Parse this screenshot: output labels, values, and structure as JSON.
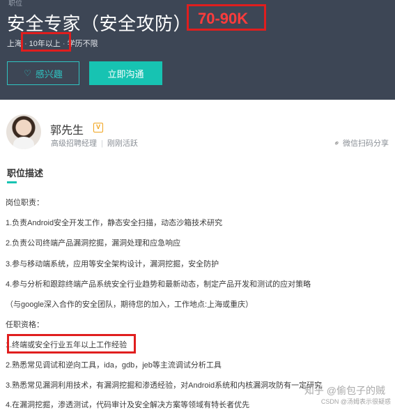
{
  "header": {
    "top_fragment": "职位",
    "title": "安全专家（安全攻防）",
    "salary": "70-90K",
    "meta": {
      "city": "上海",
      "experience": "10年以上",
      "education": "学历不限"
    },
    "interest_button": "感兴趣",
    "contact_button": "立即沟通"
  },
  "recruiter": {
    "name": "郭先生",
    "verified_mark": "V",
    "role": "高级招聘经理",
    "status": "刚刚活跃",
    "share_label": "微信扫码分享"
  },
  "description": {
    "section_title": "职位描述",
    "lines": [
      "岗位职责：",
      "1.负责Android安全开发工作，静态安全扫描，动态沙箱技术研究",
      "2.负责公司终端产品漏洞挖掘，漏洞处理和应急响应",
      "3.参与移动端系统，应用等安全架构设计，漏洞挖掘，安全防护",
      "4.参与分析和跟踪终端产品系统安全行业趋势和最新动态，制定产品开发和测试的应对策略",
      "（与google深入合作的安全团队，期待您的加入，工作地点:上海或重庆）",
      "任职资格：",
      "1.终端或安全行业五年以上工作经验",
      "2.熟悉常见调试和逆向工具，ida，gdb，jeb等主流调试分析工具",
      "3.熟悉常见漏洞利用技术，有漏洞挖掘和渗透经验，对Android系统和内核漏洞攻防有一定研究",
      "4.在漏洞挖掘，渗透测试，代码审计及安全解决方案等领域有特长者优先"
    ]
  },
  "watermark": {
    "main": "知乎 @偷包子的贼",
    "sub": "CSDN @汤姆表示很疑惑"
  },
  "colors": {
    "header_bg": "#3d4655",
    "accent": "#17c3b2",
    "highlight_red": "#e01e1e"
  }
}
